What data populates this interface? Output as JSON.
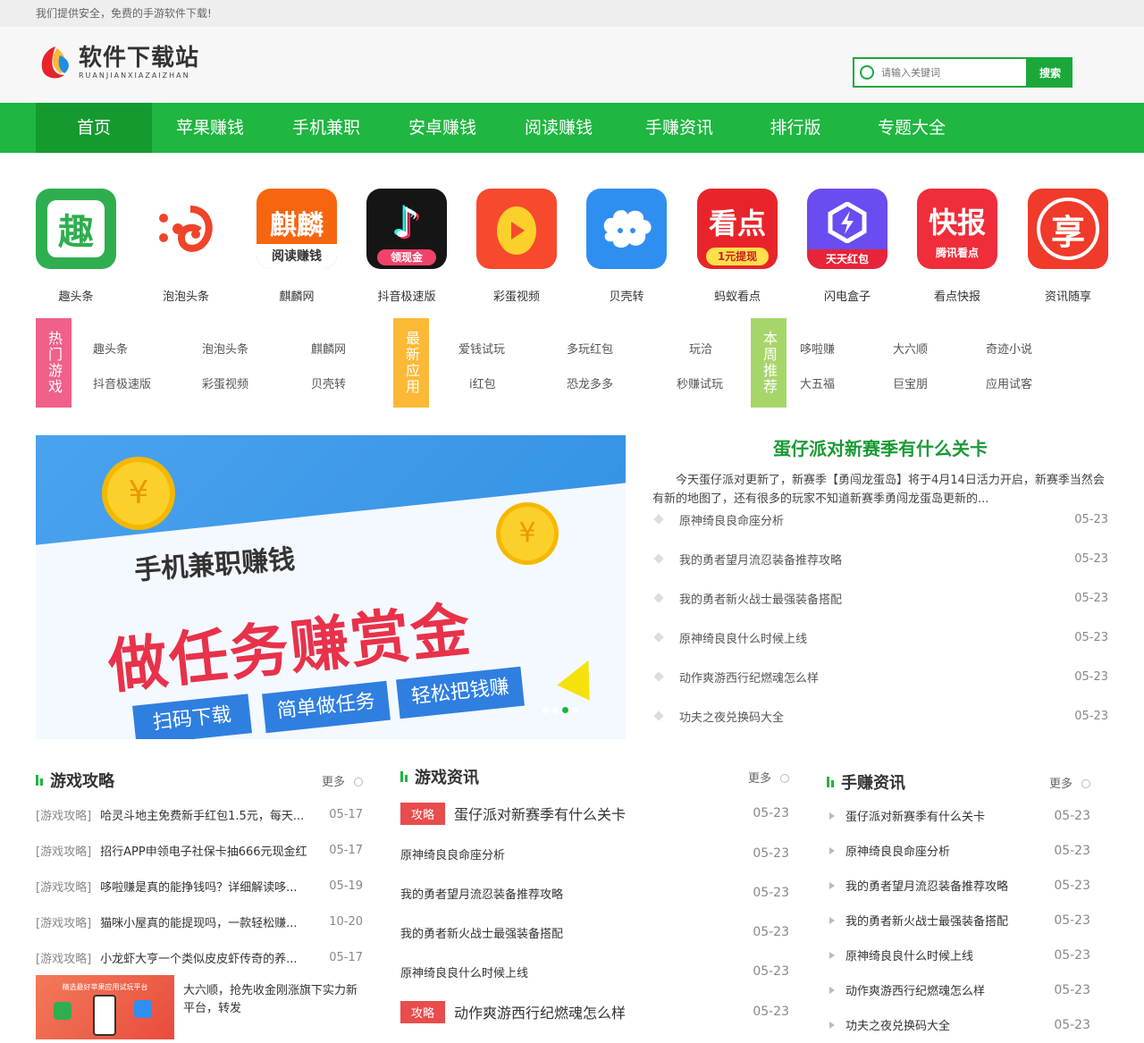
{
  "topbar": {
    "text": "我们提供安全，免费的手游软件下载!"
  },
  "logo": {
    "main": "软件下载站",
    "sub": "RUANJIANXIAZAIZHAN"
  },
  "search": {
    "placeholder": "请输入关键词",
    "button": "搜索"
  },
  "nav": [
    {
      "label": "首页",
      "active": true
    },
    {
      "label": "苹果赚钱"
    },
    {
      "label": "手机兼职"
    },
    {
      "label": "安卓赚钱"
    },
    {
      "label": "阅读赚钱"
    },
    {
      "label": "手赚资讯"
    },
    {
      "label": "排行版"
    },
    {
      "label": "专题大全"
    }
  ],
  "apps": [
    {
      "name": "趣头条",
      "icon": "qutoutiao-icon",
      "glyph": "趣",
      "color": "#2fae4f"
    },
    {
      "name": "泡泡头条",
      "icon": "paopao-icon",
      "glyph": "",
      "color": "#ffffff"
    },
    {
      "name": "麒麟网",
      "icon": "qilin-icon",
      "glyph": "麒麟",
      "sub": "阅读赚钱",
      "color": "#f7650f"
    },
    {
      "name": "抖音极速版",
      "icon": "douyin-icon",
      "glyph": "♪",
      "sub": "领现金",
      "color": "#151515"
    },
    {
      "name": "彩蛋视频",
      "icon": "caidan-icon",
      "glyph": "",
      "color": "#f7492e"
    },
    {
      "name": "贝壳转",
      "icon": "beike-icon",
      "glyph": "",
      "color": "#2f8ff0"
    },
    {
      "name": "蚂蚁看点",
      "icon": "mayi-icon",
      "glyph": "看点",
      "sub": "1元提现",
      "color": "#e8242a"
    },
    {
      "name": "闪电盒子",
      "icon": "shandian-icon",
      "glyph": "",
      "sub": "天天红包",
      "color": "#6a4cf0"
    },
    {
      "name": "看点快报",
      "icon": "kandian-icon",
      "glyph": "快报",
      "sub": "腾讯看点",
      "color": "#f02d3a"
    },
    {
      "name": "资讯随享",
      "icon": "zixun-icon",
      "glyph": "享",
      "color": "#f03a2a"
    }
  ],
  "tags": [
    {
      "label": "热门游戏",
      "color": "#f0608a",
      "links": [
        "趣头条",
        "泡泡头条",
        "麒麟网",
        "抖音极速版",
        "彩蛋视频",
        "贝壳转"
      ]
    },
    {
      "label": "最新应用",
      "color": "#fbb936",
      "links": [
        "爱钱试玩",
        "多玩红包",
        "玩洽",
        "i红包",
        "恐龙多多",
        "秒赚试玩"
      ]
    },
    {
      "label": "本周推荐",
      "color": "#a6d66a",
      "links": [
        "哆啦赚",
        "大六顺",
        "奇迹小说",
        "大五福",
        "巨宝朋",
        "应用试客"
      ]
    }
  ],
  "banner": {
    "line1": "手机兼职赚钱",
    "line2": "做任务赚赏金",
    "tabs": [
      "扫码下载",
      "简单做任务",
      "轻松把钱赚"
    ]
  },
  "featured": {
    "title": "蛋仔派对新赛季有什么关卡",
    "desc": "今天蛋仔派对更新了，新赛季【勇闯龙蛋岛】将于4月14日活力开启，新赛季当然会有新的地图了，还有很多的玩家不知道新赛季勇闯龙蛋岛更新的...",
    "items": [
      {
        "title": "原神绮良良命座分析",
        "date": "05-23"
      },
      {
        "title": "我的勇者望月流忍装备推荐攻略",
        "date": "05-23"
      },
      {
        "title": "我的勇者新火战士最强装备搭配",
        "date": "05-23"
      },
      {
        "title": "原神绮良良什么时候上线",
        "date": "05-23"
      },
      {
        "title": "动作爽游西行纪燃魂怎么样",
        "date": "05-23"
      },
      {
        "title": "功夫之夜兑换码大全",
        "date": "05-23"
      }
    ]
  },
  "col1": {
    "title": "游戏攻略",
    "more": "更多",
    "items": [
      {
        "cat": "[游戏攻略]",
        "title": "哈灵斗地主免费新手红包1.5元，每天...",
        "date": "05-17"
      },
      {
        "cat": "[游戏攻略]",
        "title": "招行APP申领电子社保卡抽666元现金红",
        "date": "05-17"
      },
      {
        "cat": "[游戏攻略]",
        "title": "哆啦赚是真的能挣钱吗？详细解读哆...",
        "date": "05-19"
      },
      {
        "cat": "[游戏攻略]",
        "title": "猫咪小屋真的能提现吗，一款轻松赚...",
        "date": "10-20"
      },
      {
        "cat": "[游戏攻略]",
        "title": "小龙虾大亨一个类似皮皮虾传奇的养...",
        "date": "05-17"
      }
    ],
    "feature": {
      "text": "大六顺，抢先收金刚涨旗下实力新平台，转发",
      "img_caption": "精选最好苹果应用试玩平台"
    }
  },
  "col2": {
    "title": "游戏资讯",
    "more": "更多",
    "badge": "攻略",
    "items": [
      {
        "title": "蛋仔派对新赛季有什么关卡",
        "date": "05-23",
        "badge": true
      },
      {
        "title": "原神绮良良命座分析",
        "date": "05-23"
      },
      {
        "title": "我的勇者望月流忍装备推荐攻略",
        "date": "05-23"
      },
      {
        "title": "我的勇者新火战士最强装备搭配",
        "date": "05-23"
      },
      {
        "title": "原神绮良良什么时候上线",
        "date": "05-23"
      },
      {
        "title": "动作爽游西行纪燃魂怎么样",
        "date": "05-23",
        "badge": true
      }
    ]
  },
  "col3": {
    "title": "手赚资讯",
    "more": "更多",
    "items": [
      {
        "title": "蛋仔派对新赛季有什么关卡",
        "date": "05-23"
      },
      {
        "title": "原神绮良良命座分析",
        "date": "05-23"
      },
      {
        "title": "我的勇者望月流忍装备推荐攻略",
        "date": "05-23"
      },
      {
        "title": "我的勇者新火战士最强装备搭配",
        "date": "05-23"
      },
      {
        "title": "原神绮良良什么时候上线",
        "date": "05-23"
      },
      {
        "title": "动作爽游西行纪燃魂怎么样",
        "date": "05-23"
      },
      {
        "title": "功夫之夜兑换码大全",
        "date": "05-23"
      }
    ]
  }
}
